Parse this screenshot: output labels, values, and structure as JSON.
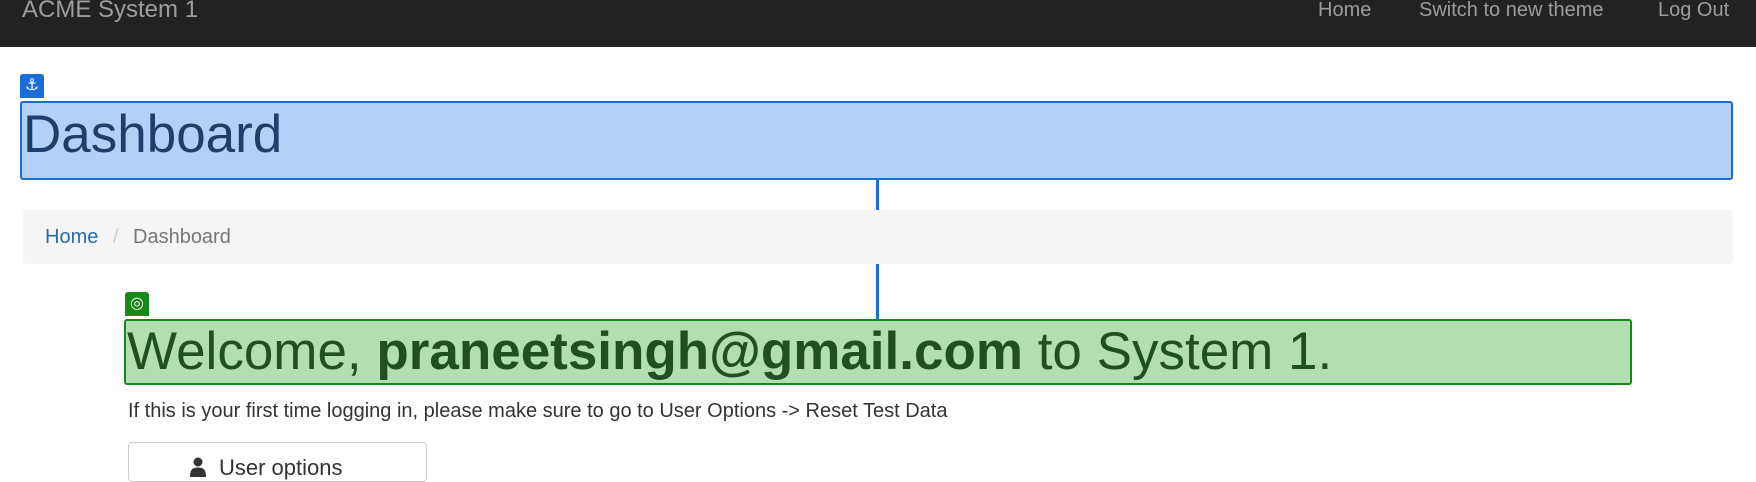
{
  "navbar": {
    "brand": "ACME System 1",
    "links": [
      "Home",
      "Switch to new theme",
      "Log Out"
    ]
  },
  "overlay": {
    "anchor_icon": "anchor-icon",
    "target_icon": "target-icon",
    "colors": {
      "anchor": "#1a6dd6",
      "target": "#168a16"
    }
  },
  "page": {
    "title": "Dashboard"
  },
  "breadcrumb": {
    "home": "Home",
    "separator": "/",
    "current": "Dashboard"
  },
  "welcome": {
    "prefix": "Welcome, ",
    "email": "praneetsingh@gmail.com",
    "suffix": " to System 1."
  },
  "info_text": "If this is your first time logging in, please make sure to go to User Options -> Reset Test Data",
  "user_options": {
    "icon": "user-icon",
    "label": "User options"
  }
}
